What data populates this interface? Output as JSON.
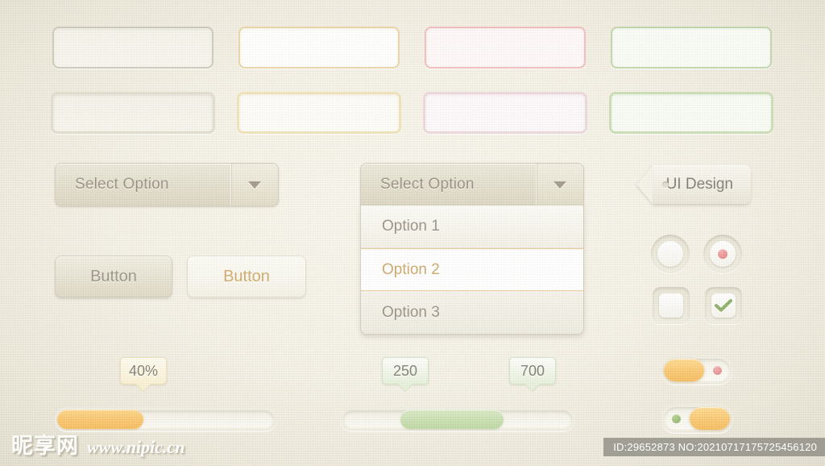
{
  "meta": {
    "background_color": "#f2eee2",
    "accent_orange": "#f5b347",
    "accent_green": "#b4d296",
    "accent_pink": "#d96a6a",
    "text_color": "#8a8070"
  },
  "inputs": {
    "row1": [
      {
        "name": "input-grey-focus",
        "style": "grey"
      },
      {
        "name": "input-gold-focus",
        "style": "gold"
      },
      {
        "name": "input-pink-focus",
        "style": "pink"
      },
      {
        "name": "input-green-focus",
        "style": "green"
      }
    ],
    "row2": [
      {
        "name": "input-grey-glow",
        "style": "grey2"
      },
      {
        "name": "input-gold-glow",
        "style": "gold2"
      },
      {
        "name": "input-pink-glow",
        "style": "pink2"
      },
      {
        "name": "input-green-glow",
        "style": "green2"
      }
    ],
    "placeholder": ""
  },
  "selects": {
    "closed": {
      "value": "Select Option",
      "arrow": "chevron-down-icon"
    },
    "open": {
      "value": "Select Option",
      "arrow": "chevron-down-icon",
      "options": [
        {
          "label": "Option 1",
          "selected": false
        },
        {
          "label": "Option 2",
          "selected": true
        },
        {
          "label": "Option 3",
          "selected": false
        }
      ]
    }
  },
  "tag": {
    "label": "UI Design"
  },
  "buttons": {
    "primary": {
      "label": "Button"
    },
    "secondary": {
      "label": "Button"
    }
  },
  "choices": {
    "radio_off": {
      "name": "radio-unchecked",
      "checked": false
    },
    "radio_on": {
      "name": "radio-checked",
      "checked": true,
      "dot_color": "#d96a6a"
    },
    "checkbox_off": {
      "name": "checkbox-unchecked",
      "checked": false
    },
    "checkbox_on": {
      "name": "checkbox-checked",
      "checked": true,
      "check_color": "#7ba352"
    }
  },
  "sliders": {
    "single": {
      "label": "40%",
      "value": 40,
      "min": 0,
      "max": 100,
      "fill_color": "#f5b347"
    },
    "range": {
      "low_label": "250",
      "high_label": "700",
      "low": 250,
      "high": 700,
      "min": 0,
      "max": 1000,
      "fill_color": "#b4d296"
    }
  },
  "toggles": {
    "off": {
      "state": "off",
      "indicator_color": "#d96a6a",
      "knob_side": "left"
    },
    "on": {
      "state": "on",
      "indicator_color": "#7ba352",
      "knob_side": "right"
    }
  },
  "watermark": {
    "site_cn": "昵享网",
    "site_url": "www.nipic.cn",
    "id_line": "ID:29652873 NO:20210717175725456120"
  }
}
